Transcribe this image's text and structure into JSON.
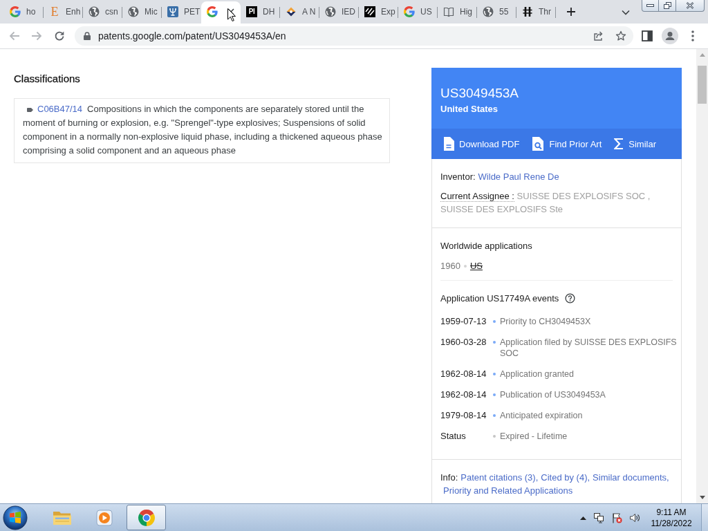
{
  "browser": {
    "tabs": [
      {
        "kind": "google",
        "title": "ho",
        "selected": false
      },
      {
        "kind": "letter",
        "logo": "E",
        "title": "Enh",
        "selected": false
      },
      {
        "kind": "globe",
        "title": "csn",
        "selected": false
      },
      {
        "kind": "globe",
        "title": "Mic",
        "selected": false
      },
      {
        "kind": "emblem",
        "title": "PET",
        "selected": false
      },
      {
        "kind": "google",
        "selected": true
      },
      {
        "kind": "badge",
        "logo": "PI",
        "title": "DH",
        "selected": false
      },
      {
        "kind": "diamond",
        "title": "A N",
        "selected": false
      },
      {
        "kind": "globe",
        "title": "IED",
        "selected": false
      },
      {
        "kind": "stripes",
        "title": "Exp",
        "selected": false
      },
      {
        "kind": "google",
        "title": "US",
        "selected": false
      },
      {
        "kind": "book",
        "title": "Hig",
        "selected": false
      },
      {
        "kind": "globe",
        "title": "55",
        "selected": false
      },
      {
        "kind": "bars",
        "title": "Thr",
        "selected": false
      }
    ],
    "back": {
      "disabled": true
    },
    "forward": {
      "disabled": true
    },
    "address": {
      "url": "patents.google.com/patent/US3049453A/en",
      "secure": true
    }
  },
  "page": {
    "classifications": {
      "heading": "Classifications",
      "items": [
        {
          "code": "C06B47/14",
          "description": "Compositions in which the components are separately stored until the moment of burning or explosion, e.g. \"Sprengel\"-type explosives; Suspensions of solid component in a normally non-explosive liquid phase, including a thickened aqueous phase comprising a solid component and an aqueous phase"
        }
      ]
    },
    "card": {
      "number": "US3049453A",
      "country": "United States",
      "actions": [
        {
          "kind": "pdf",
          "label": "Download PDF"
        },
        {
          "kind": "prior_art",
          "label": "Find Prior Art"
        },
        {
          "kind": "similar",
          "label": "Similar"
        }
      ],
      "inventor": {
        "label": "Inventor:",
        "name": "Wilde Paul Rene De"
      },
      "assignee": {
        "label": "Current Assignee :",
        "name": "SUISSE DES EXPLOSIFS SOC , SUISSE DES EXPLOSIFS Ste"
      },
      "worldwide": {
        "heading": "Worldwide applications",
        "items": [
          {
            "year": "1960",
            "country": "US",
            "expired": true
          }
        ]
      },
      "events": {
        "heading": "Application US17749A events",
        "rows": [
          {
            "date": "1959-07-13",
            "text": "Priority to CH3049453X",
            "color": "#7baaf7"
          },
          {
            "date": "1960-03-28",
            "text": "Application filed by SUISSE DES EXPLOSIFS SOC",
            "color": "#7baaf7"
          },
          {
            "date": "1962-08-14",
            "text": "Application granted",
            "color": "#7baaf7"
          },
          {
            "date": "1962-08-14",
            "text": "Publication of US3049453A",
            "color": "#7baaf7"
          },
          {
            "date": "1979-08-14",
            "text": "Anticipated expiration",
            "color": "#7baaf7"
          },
          {
            "date": "Status",
            "text": "Expired - Lifetime",
            "color": "#c6c6c6"
          }
        ]
      },
      "info": {
        "label": "Info:",
        "links": [
          "Patent citations (3),",
          "Cited by (4),",
          "Similar documents,",
          "Priority and Related Applications"
        ]
      }
    }
  },
  "taskbar": {
    "apps": [
      {
        "kind": "folder",
        "active": false
      },
      {
        "kind": "media",
        "active": false
      },
      {
        "kind": "chrome",
        "active": true
      }
    ],
    "clock": {
      "time": "9:11 AM",
      "date": "11/28/2022"
    }
  }
}
